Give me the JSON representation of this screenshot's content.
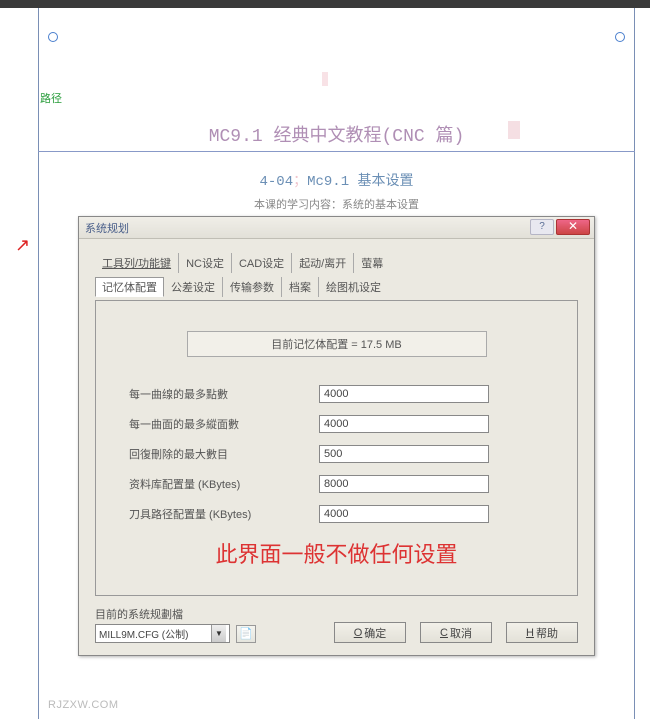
{
  "path_label": "路径",
  "main_title": "MC9.1 经典中文教程(CNC 篇)",
  "subtitle_prefix": "4-04",
  "subtitle_sep": "；",
  "subtitle_rest": "Mc9.1 基本设置",
  "lesson_desc": "本课的学习内容：系统的基本设置",
  "dialog": {
    "title": "系统规划",
    "help_char": "?",
    "close_char": "✕",
    "tabs_row1": [
      "工具列/功能键",
      "NC设定",
      "CAD设定",
      "起动/离开",
      "萤幕"
    ],
    "tabs_row2": [
      "记忆体配置",
      "公差设定",
      "传输参数",
      "档案",
      "绘图机设定"
    ],
    "active_tab": "记忆体配置",
    "memory_label": "目前记忆体配置 = 17.5 MB",
    "fields": [
      {
        "label": "每一曲缐的最多點數",
        "value": "4000"
      },
      {
        "label": "每一曲面的最多縱面數",
        "value": "4000"
      },
      {
        "label": "回復刪除的最大數目",
        "value": "500"
      },
      {
        "label": "资料库配置量 (KBytes)",
        "value": "8000"
      },
      {
        "label": "刀具路径配置量 (KBytes)",
        "value": "4000"
      }
    ],
    "red_note": "此界面一般不做任何设置",
    "cfg_label": "目前的系统规劃檔",
    "cfg_value": "MILL9M.CFG (公制)",
    "buttons": {
      "ok_m": "O",
      "ok": "确定",
      "cancel_m": "C",
      "cancel": "取消",
      "help_m": "H",
      "help": "帮助"
    }
  },
  "watermark": "RJZXW.COM"
}
